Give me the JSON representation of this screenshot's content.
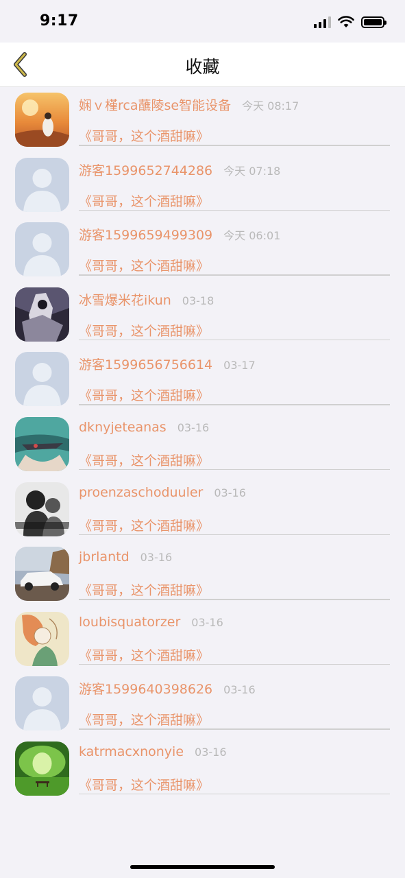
{
  "status_bar": {
    "time": "9:17"
  },
  "nav": {
    "title": "收藏"
  },
  "colors": {
    "accent": "#e9946a",
    "timestamp": "#b9b9b9",
    "back_arrow": "#cdb84a"
  },
  "items": [
    {
      "name": "娴ｖ槿rca蘸陵se智能设备",
      "time": "今天 08:17",
      "message": "《哥哥，这个酒甜嘛》",
      "avatar": "sunset-girl"
    },
    {
      "name": "游客1599652744286",
      "time": "今天 07:18",
      "message": "《哥哥，这个酒甜嘛》",
      "avatar": "default"
    },
    {
      "name": "游客1599659499309",
      "time": "今天 06:01",
      "message": "《哥哥，这个酒甜嘛》",
      "avatar": "default"
    },
    {
      "name": "冰雪爆米花ikun",
      "time": "03-18",
      "message": "《哥哥，这个酒甜嘛》",
      "avatar": "anime-dark"
    },
    {
      "name": "游客1599656756614",
      "time": "03-17",
      "message": "《哥哥，这个酒甜嘛》",
      "avatar": "default"
    },
    {
      "name": "dknyjeteanas",
      "time": "03-16",
      "message": "《哥哥，这个酒甜嘛》",
      "avatar": "teal-scene"
    },
    {
      "name": "proenzaschoduuler",
      "time": "03-16",
      "message": "《哥哥，这个酒甜嘛》",
      "avatar": "bw-couple"
    },
    {
      "name": "jbrlantd",
      "time": "03-16",
      "message": "《哥哥，这个酒甜嘛》",
      "avatar": "white-car"
    },
    {
      "name": "loubisquatorzer",
      "time": "03-16",
      "message": "《哥哥，这个酒甜嘛》",
      "avatar": "sketch-girl"
    },
    {
      "name": "游客1599640398626",
      "time": "03-16",
      "message": "《哥哥，这个酒甜嘛》",
      "avatar": "default"
    },
    {
      "name": "katrmacxnonyie",
      "time": "03-16",
      "message": "《哥哥，这个酒甜嘛》",
      "avatar": "green-park"
    }
  ]
}
